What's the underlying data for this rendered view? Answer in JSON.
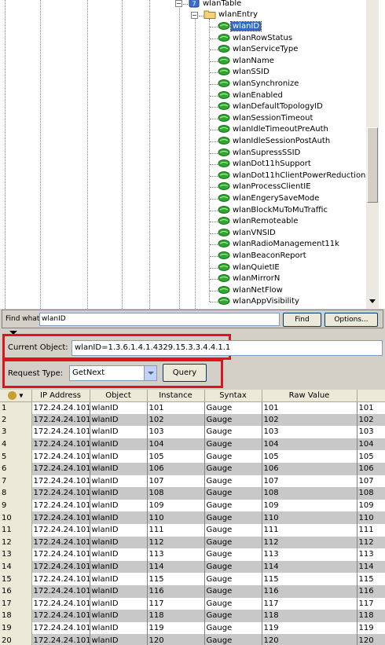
{
  "tree": {
    "table_node": "wlanTable",
    "entry_node": "wlanEntry",
    "selected": "wlanID",
    "leaves": [
      "wlanID",
      "wlanRowStatus",
      "wlanServiceType",
      "wlanName",
      "wlanSSID",
      "wlanSynchronize",
      "wlanEnabled",
      "wlanDefaultTopologyID",
      "wlanSessionTimeout",
      "wlanIdleTimeoutPreAuth",
      "wlanIdleSessionPostAuth",
      "wlanSupressSSID",
      "wlanDot11hSupport",
      "wlanDot11hClientPowerReduction",
      "wlanProcessClientIE",
      "wlanEngerySaveMode",
      "wlanBlockMuToMuTraffic",
      "wlanRemoteable",
      "wlanVNSID",
      "wlanRadioManagement11k",
      "wlanBeaconReport",
      "wlanQuietIE",
      "wlanMirrorN",
      "wlanNetFlow",
      "wlanAppVisibility"
    ]
  },
  "find": {
    "label": "Find what:",
    "value": "wlanID",
    "find_button": "Find",
    "options_button": "Options..."
  },
  "current_object": {
    "label": "Current Object:",
    "value": "wlanID=1.3.6.1.4.1.4329.15.3.3.4.4.1.1"
  },
  "request": {
    "label": "Request Type:",
    "selected": "GetNext",
    "query_button": "Query"
  },
  "results": {
    "columns": [
      "IP Address",
      "Object",
      "Instance",
      "Syntax",
      "Raw Value"
    ],
    "rows": [
      [
        "1",
        "172.24.24.101",
        "wlanID",
        "101",
        "Gauge",
        "101",
        "101"
      ],
      [
        "2",
        "172.24.24.101",
        "wlanID",
        "102",
        "Gauge",
        "102",
        "102"
      ],
      [
        "3",
        "172.24.24.101",
        "wlanID",
        "103",
        "Gauge",
        "103",
        "103"
      ],
      [
        "4",
        "172.24.24.101",
        "wlanID",
        "104",
        "Gauge",
        "104",
        "104"
      ],
      [
        "5",
        "172.24.24.101",
        "wlanID",
        "105",
        "Gauge",
        "105",
        "105"
      ],
      [
        "6",
        "172.24.24.101",
        "wlanID",
        "106",
        "Gauge",
        "106",
        "106"
      ],
      [
        "7",
        "172.24.24.101",
        "wlanID",
        "107",
        "Gauge",
        "107",
        "107"
      ],
      [
        "8",
        "172.24.24.101",
        "wlanID",
        "108",
        "Gauge",
        "108",
        "108"
      ],
      [
        "9",
        "172.24.24.101",
        "wlanID",
        "109",
        "Gauge",
        "109",
        "109"
      ],
      [
        "10",
        "172.24.24.101",
        "wlanID",
        "110",
        "Gauge",
        "110",
        "110"
      ],
      [
        "11",
        "172.24.24.101",
        "wlanID",
        "111",
        "Gauge",
        "111",
        "111"
      ],
      [
        "12",
        "172.24.24.101",
        "wlanID",
        "112",
        "Gauge",
        "112",
        "112"
      ],
      [
        "13",
        "172.24.24.101",
        "wlanID",
        "113",
        "Gauge",
        "113",
        "113"
      ],
      [
        "14",
        "172.24.24.101",
        "wlanID",
        "114",
        "Gauge",
        "114",
        "114"
      ],
      [
        "15",
        "172.24.24.101",
        "wlanID",
        "115",
        "Gauge",
        "115",
        "115"
      ],
      [
        "16",
        "172.24.24.101",
        "wlanID",
        "116",
        "Gauge",
        "116",
        "116"
      ],
      [
        "17",
        "172.24.24.101",
        "wlanID",
        "117",
        "Gauge",
        "117",
        "117"
      ],
      [
        "18",
        "172.24.24.101",
        "wlanID",
        "118",
        "Gauge",
        "118",
        "118"
      ],
      [
        "19",
        "172.24.24.101",
        "wlanID",
        "119",
        "Gauge",
        "119",
        "119"
      ],
      [
        "20",
        "172.24.24.101",
        "wlanID",
        "120",
        "Gauge",
        "120",
        "120"
      ]
    ]
  },
  "colors": {
    "highlight_box": "#e0141e",
    "selection": "#316ac5",
    "row_alt": "#c8c8c8",
    "leaf_icon": "#2ea82e"
  }
}
